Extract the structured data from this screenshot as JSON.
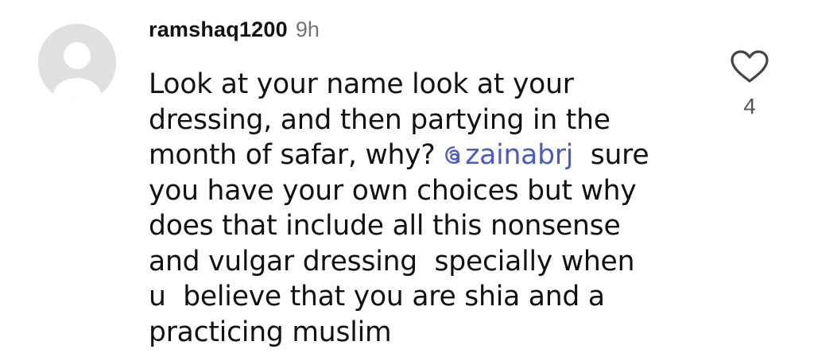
{
  "comment": {
    "username": "ramshaq1200",
    "time": "9h",
    "lines": [
      {
        "text": "Look at your name look at your"
      },
      {
        "text": "dressing, and then partying in the"
      },
      {
        "before": "month of safar, why? ",
        "mention": "zainabrj",
        "after": "  sure"
      },
      {
        "text": "you have your own choices but why"
      },
      {
        "text": "does that include all this nonsense"
      },
      {
        "text": "and vulgar dressing  specially when"
      },
      {
        "text": "u  believe that you are shia and a"
      },
      {
        "text": "practicing muslim"
      }
    ],
    "like_count": "4"
  },
  "icons": {
    "avatar": "default-avatar",
    "mention": "threads-icon",
    "like": "heart-outline-icon"
  },
  "colors": {
    "mention": "#4a5ac8",
    "muted": "#737373",
    "avatar_bg": "#e0e0e0"
  }
}
